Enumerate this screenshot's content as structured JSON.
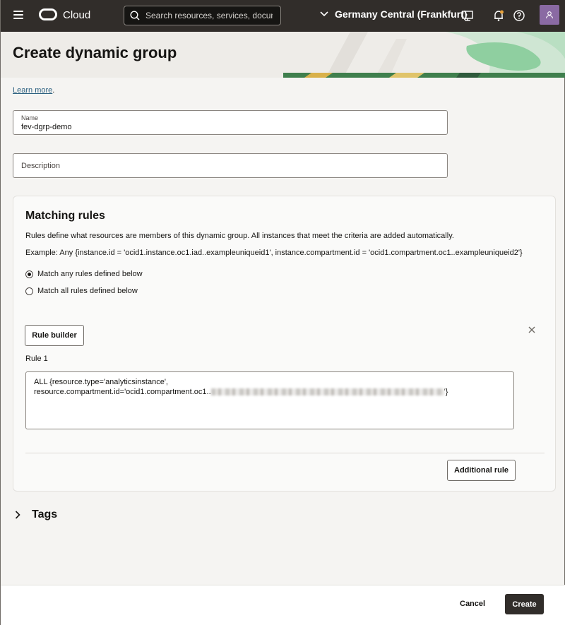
{
  "topbar": {
    "brand": "Cloud",
    "search_placeholder": "Search resources, services, documentation",
    "region": "Germany Central (Frankfurt)"
  },
  "page": {
    "title": "Create dynamic group",
    "learn_more": "Learn more",
    "learn_more_suffix": "."
  },
  "form": {
    "name_label": "Name",
    "name_value": "fev-dgrp-demo",
    "description_placeholder": "Description"
  },
  "matching_rules": {
    "heading": "Matching rules",
    "description": "Rules define what resources are members of this dynamic group. All instances that meet the criteria are added automatically.",
    "example": "Example: Any {instance.id = 'ocid1.instance.oc1.iad..exampleuniqueid1', instance.compartment.id = 'ocid1.compartment.oc1..exampleuniqueid2'}",
    "options": [
      {
        "label": "Match any rules defined below",
        "selected": true
      },
      {
        "label": "Match all rules defined below",
        "selected": false
      }
    ],
    "rule_builder_label": "Rule builder",
    "rule_label": "Rule 1",
    "rule_line1": "ALL {resource.type='analyticsinstance',",
    "rule_line2_prefix": "resource.compartment.id='ocid1.compartment.oc1..",
    "rule_line2_suffix": "'}",
    "additional_rule_label": "Additional rule"
  },
  "tags": {
    "label": "Tags"
  },
  "footer": {
    "cancel": "Cancel",
    "create": "Create"
  },
  "colors": {
    "topbar": "#312d2a",
    "primary_button": "#312d2a",
    "link": "#2a5f7f",
    "avatar": "#8a6aa3"
  }
}
